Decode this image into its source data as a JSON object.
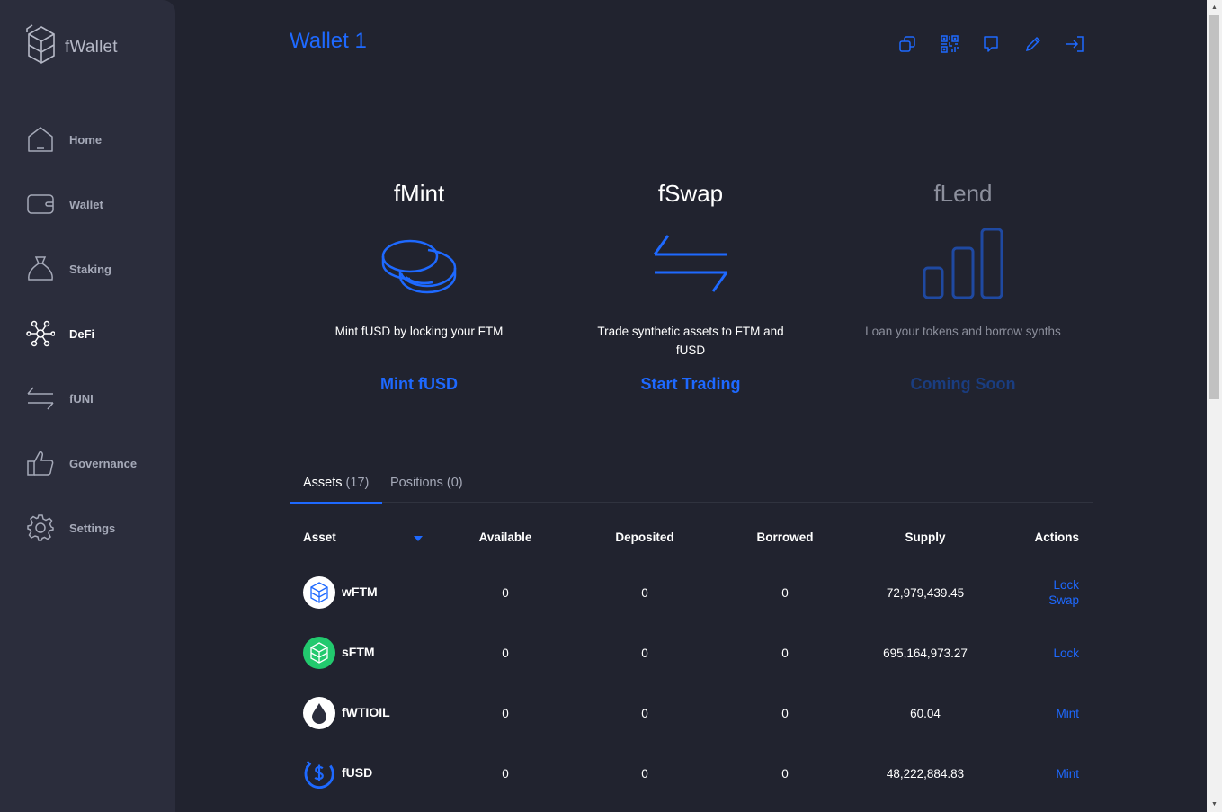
{
  "app": {
    "name": "fWallet"
  },
  "nav": [
    {
      "label": "Home",
      "icon": "home-icon"
    },
    {
      "label": "Wallet",
      "icon": "wallet-icon"
    },
    {
      "label": "Staking",
      "icon": "staking-bag-icon"
    },
    {
      "label": "DeFi",
      "icon": "defi-network-icon",
      "active": true
    },
    {
      "label": "fUNI",
      "icon": "swap-arrows-icon"
    },
    {
      "label": "Governance",
      "icon": "thumbs-up-icon"
    },
    {
      "label": "Settings",
      "icon": "gear-icon"
    }
  ],
  "header": {
    "title": "Wallet 1",
    "actions": [
      "copy-icon",
      "qr-code-icon",
      "ledger-icon",
      "edit-pencil-icon",
      "logout-icon"
    ]
  },
  "features": [
    {
      "title": "fMint",
      "description": "Mint fUSD by locking your FTM",
      "link": "Mint fUSD",
      "icon": "coins-icon"
    },
    {
      "title": "fSwap",
      "description": "Trade synthetic assets to FTM and fUSD",
      "link": "Start Trading",
      "icon": "swap-arrows-icon"
    },
    {
      "title": "fLend",
      "description": "Loan your tokens and borrow synths",
      "link": "Coming Soon",
      "icon": "bar-chart-icon",
      "disabled": true
    }
  ],
  "tabs": [
    {
      "label": "Assets",
      "count": "(17)",
      "active": true
    },
    {
      "label": "Positions",
      "count": "(0)"
    }
  ],
  "table": {
    "headers": [
      "Asset",
      "Available",
      "Deposited",
      "Borrowed",
      "Supply",
      "Actions"
    ],
    "rows": [
      {
        "asset": "wFTM",
        "icon": "wftm-token-icon",
        "available": "0",
        "deposited": "0",
        "borrowed": "0",
        "supply": "72,979,439.45",
        "actions": [
          "Lock",
          "Swap"
        ]
      },
      {
        "asset": "sFTM",
        "icon": "sftm-token-icon",
        "available": "0",
        "deposited": "0",
        "borrowed": "0",
        "supply": "695,164,973.27",
        "actions": [
          "Lock"
        ]
      },
      {
        "asset": "fWTIOIL",
        "icon": "oil-drop-icon",
        "available": "0",
        "deposited": "0",
        "borrowed": "0",
        "supply": "60.04",
        "actions": [
          "Mint"
        ]
      },
      {
        "asset": "fUSD",
        "icon": "fusd-token-icon",
        "available": "0",
        "deposited": "0",
        "borrowed": "0",
        "supply": "48,222,884.83",
        "actions": [
          "Mint"
        ]
      }
    ]
  },
  "colors": {
    "accent": "#1e69ff",
    "background": "#21232f",
    "sidebar": "#2b2d3c",
    "muted": "#a5a9b8"
  }
}
